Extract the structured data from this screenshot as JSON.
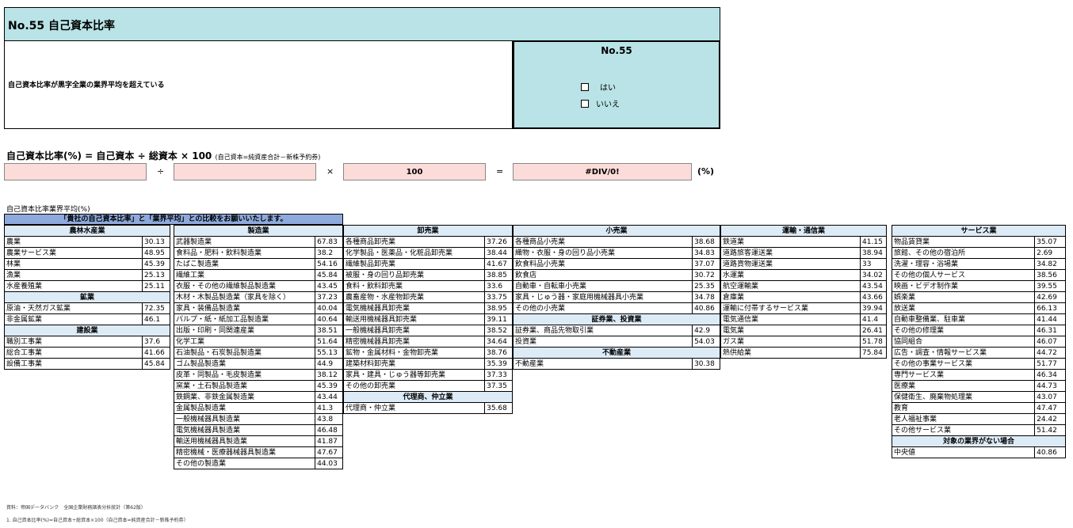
{
  "title": "No.55 自己資本比率",
  "question": "自己資本比率が黒字全業の業界平均を超えている",
  "answer_box": {
    "title": "No.55",
    "options": [
      "はい",
      "いいえ"
    ]
  },
  "formula": {
    "main": "自己資本比率(%) = 自己資本 ÷ 総資本 × 100",
    "note": "(自己資本=純資産合計－新株予約券)"
  },
  "calc": {
    "divide": "÷",
    "times": "×",
    "equals": "=",
    "value3": "100",
    "result": "#DIV/0!",
    "unit": "(%)"
  },
  "subheading": "自己資本比率業界平均(%)",
  "notice": "「貴社の自己資本比率」と「業界平均」との比較をお願いいたします。",
  "columns": [
    {
      "rows": [
        {
          "h": "農林水産業"
        },
        {
          "n": "農業",
          "v": "30.13"
        },
        {
          "n": "農業サービス業",
          "v": "48.95"
        },
        {
          "n": "林業",
          "v": "45.39"
        },
        {
          "n": "漁業",
          "v": "25.13"
        },
        {
          "n": "水産養殖業",
          "v": "25.11"
        },
        {
          "h": "鉱業"
        },
        {
          "n": "原油・天然ガス鉱業",
          "v": "72.35"
        },
        {
          "n": "非金属鉱業",
          "v": "46.1"
        },
        {
          "h": "建設業"
        },
        {
          "n": "職別工事業",
          "v": "37.6"
        },
        {
          "n": "総合工事業",
          "v": "41.66"
        },
        {
          "n": "設備工事業",
          "v": "45.84"
        }
      ]
    },
    {
      "rows": [
        {
          "h": "製造業"
        },
        {
          "n": "武器製造業",
          "v": "67.83"
        },
        {
          "n": "食料品・肥料・飲料製造業",
          "v": "38.2"
        },
        {
          "n": "たばこ製造業",
          "v": "54.16"
        },
        {
          "n": "繊維工業",
          "v": "45.84"
        },
        {
          "n": "衣服・その他の繊維製品製造業",
          "v": "43.45"
        },
        {
          "n": "木材・木製品製造業（家具を除く）",
          "v": "37.23"
        },
        {
          "n": "家具・装備品製造業",
          "v": "40.04"
        },
        {
          "n": "パルプ・紙・紙加工品製造業",
          "v": "40.64"
        },
        {
          "n": "出版・印刷・同関連産業",
          "v": "38.51"
        },
        {
          "n": "化学工業",
          "v": "51.64"
        },
        {
          "n": "石油製品・石炭製品製造業",
          "v": "55.13"
        },
        {
          "n": "ゴム製品製造業",
          "v": "44.9"
        },
        {
          "n": "皮革・同製品・毛皮製造業",
          "v": "38.12"
        },
        {
          "n": "窯業・土石製品製造業",
          "v": "45.39"
        },
        {
          "n": "鉄鋼業、非鉄金属製造業",
          "v": "43.44"
        },
        {
          "n": "金属製品製造業",
          "v": "41.3"
        },
        {
          "n": "一般機械器具製造業",
          "v": "43.8"
        },
        {
          "n": "電気機械器具製造業",
          "v": "46.48"
        },
        {
          "n": "輸送用機械器具製造業",
          "v": "41.87"
        },
        {
          "n": "精密機械・医療器械器具製造業",
          "v": "47.67"
        },
        {
          "n": "その他の製造業",
          "v": "44.03"
        }
      ]
    },
    {
      "rows": [
        {
          "h": "卸売業"
        },
        {
          "n": "各種商品卸売業",
          "v": "37.26"
        },
        {
          "n": "化学製品・医薬品・化粧品卸売業",
          "v": "38.44"
        },
        {
          "n": "繊維製品卸売業",
          "v": "41.67"
        },
        {
          "n": "被服・身の回り品卸売業",
          "v": "38.85"
        },
        {
          "n": "食料・飲料卸売業",
          "v": "33.6"
        },
        {
          "n": "農畜産物・水産物卸売業",
          "v": "33.75"
        },
        {
          "n": "電気機械器具卸売業",
          "v": "38.95"
        },
        {
          "n": "輸送用機械器具卸売業",
          "v": "39.11"
        },
        {
          "n": "一般機械器具卸売業",
          "v": "38.52"
        },
        {
          "n": "精密機械器具卸売業",
          "v": "34.64"
        },
        {
          "n": "鉱物・金属材料・金物卸売業",
          "v": "38.76"
        },
        {
          "n": "建築材料卸売業",
          "v": "35.39"
        },
        {
          "n": "家具・建具・じゅう器等卸売業",
          "v": "37.33"
        },
        {
          "n": "その他の卸売業",
          "v": "37.35"
        },
        {
          "h": "代理商、仲立業"
        },
        {
          "n": "代理商・仲立業",
          "v": "35.68"
        }
      ]
    },
    {
      "rows": [
        {
          "h": "小売業"
        },
        {
          "n": "各種商品小売業",
          "v": "38.68"
        },
        {
          "n": "織物・衣服・身の回り品小売業",
          "v": "34.83"
        },
        {
          "n": "飲食料品小売業",
          "v": "37.07"
        },
        {
          "n": "飲食店",
          "v": "30.72"
        },
        {
          "n": "自動車・自転車小売業",
          "v": "25.35"
        },
        {
          "n": "家具・じゅう器・家庭用機械器具小売業",
          "v": "34.78"
        },
        {
          "n": "その他の小売業",
          "v": "40.86"
        },
        {
          "h": "証券業、投資業"
        },
        {
          "n": "証券業、商品先物取引業",
          "v": "42.9"
        },
        {
          "n": "投資業",
          "v": "54.03"
        },
        {
          "h": "不動産業"
        },
        {
          "n": "不動産業",
          "v": "30.38"
        }
      ]
    },
    {
      "rows": [
        {
          "h": "運輸・通信業"
        },
        {
          "n": "鉄道業",
          "v": "41.15"
        },
        {
          "n": "道路旅客運送業",
          "v": "38.94"
        },
        {
          "n": "道路貨物運送業",
          "v": "33"
        },
        {
          "n": "水運業",
          "v": "34.02"
        },
        {
          "n": "航空運輸業",
          "v": "43.54"
        },
        {
          "n": "倉庫業",
          "v": "43.66"
        },
        {
          "n": "運輸に付帯するサービス業",
          "v": "39.94"
        },
        {
          "n": "電気通信業",
          "v": "41.4"
        },
        {
          "n": "電気業",
          "v": "26.41"
        },
        {
          "n": "ガス業",
          "v": "51.78"
        },
        {
          "n": "熱供給業",
          "v": "75.84"
        }
      ]
    },
    {
      "rows": [
        {
          "h": "サービス業"
        },
        {
          "n": "物品賃貸業",
          "v": "35.07"
        },
        {
          "n": "旅館、その他の宿泊所",
          "v": "2.69"
        },
        {
          "n": "洗濯・理容・浴場業",
          "v": "34.82"
        },
        {
          "n": "その他の個人サービス",
          "v": "38.56"
        },
        {
          "n": "映画・ビデオ制作業",
          "v": "39.55"
        },
        {
          "n": "娯楽業",
          "v": "42.69"
        },
        {
          "n": "放送業",
          "v": "66.13"
        },
        {
          "n": "自動車整備業、駐車業",
          "v": "41.44"
        },
        {
          "n": "その他の修理業",
          "v": "46.31"
        },
        {
          "n": "協同組合",
          "v": "46.07"
        },
        {
          "n": "広告・調査・情報サービス業",
          "v": "44.72"
        },
        {
          "n": "その他の事業サービス業",
          "v": "51.77"
        },
        {
          "n": "専門サービス業",
          "v": "46.34"
        },
        {
          "n": "医療業",
          "v": "44.73"
        },
        {
          "n": "保健衛生、廃棄物処理業",
          "v": "43.07"
        },
        {
          "n": "教育",
          "v": "47.47"
        },
        {
          "n": "老人福祉事業",
          "v": "24.42"
        },
        {
          "n": "その他サービス業",
          "v": "51.42"
        },
        {
          "h": "対象の業界がない場合"
        },
        {
          "n": "中央値",
          "v": "40.86"
        }
      ]
    }
  ],
  "footer": {
    "source": "資料：帝国データバンク　全国企業財務諸表分析統計（第62版）",
    "note": "1. 自己資本比率(%)=自己資本÷総資本×100（自己資本=純資産合計－新株予約券）"
  }
}
